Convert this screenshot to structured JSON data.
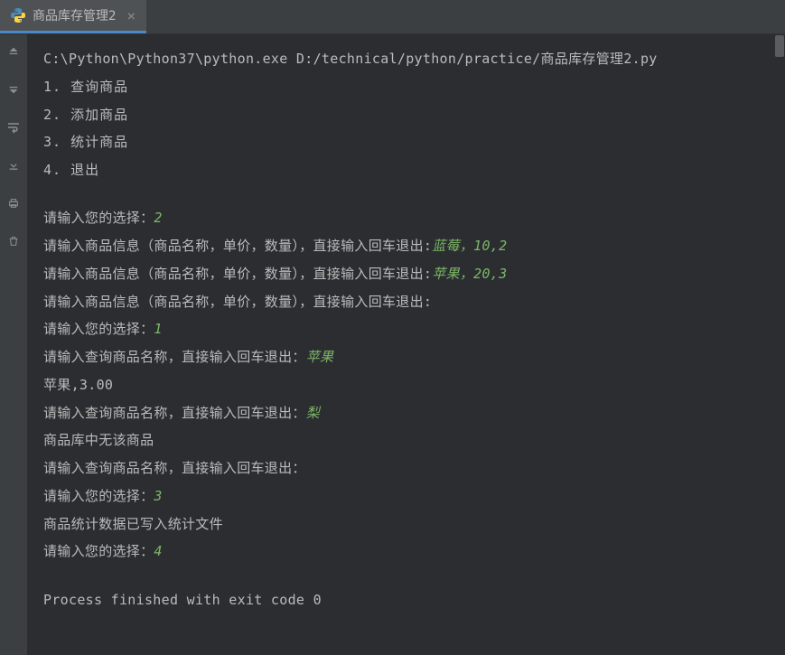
{
  "tab": {
    "title": "商品库存管理2",
    "close": "×"
  },
  "console": {
    "command": "C:\\Python\\Python37\\python.exe D:/technical/python/practice/商品库存管理2.py",
    "menu": [
      "1. 查询商品",
      "2. 添加商品",
      "3. 统计商品",
      "4. 退出"
    ],
    "lines": [
      {
        "prompt": "请输入您的选择：",
        "input": "2"
      },
      {
        "prompt": "请输入商品信息（商品名称，单价，数量），直接输入回车退出:",
        "input": "蓝莓，10,2"
      },
      {
        "prompt": "请输入商品信息（商品名称，单价，数量），直接输入回车退出:",
        "input": "苹果，20,3"
      },
      {
        "prompt": "请输入商品信息（商品名称，单价，数量），直接输入回车退出:",
        "input": ""
      },
      {
        "prompt": "请输入您的选择：",
        "input": "1"
      },
      {
        "prompt": "请输入查询商品名称，直接输入回车退出：",
        "input": "苹果"
      },
      {
        "prompt": "苹果,3.00",
        "input": null
      },
      {
        "prompt": "请输入查询商品名称，直接输入回车退出：",
        "input": "梨"
      },
      {
        "prompt": "商品库中无该商品",
        "input": null
      },
      {
        "prompt": "请输入查询商品名称，直接输入回车退出：",
        "input": ""
      },
      {
        "prompt": "请输入您的选择：",
        "input": "3"
      },
      {
        "prompt": "商品统计数据已写入统计文件",
        "input": null
      },
      {
        "prompt": "请输入您的选择：",
        "input": "4"
      }
    ],
    "exit": "Process finished with exit code 0"
  }
}
